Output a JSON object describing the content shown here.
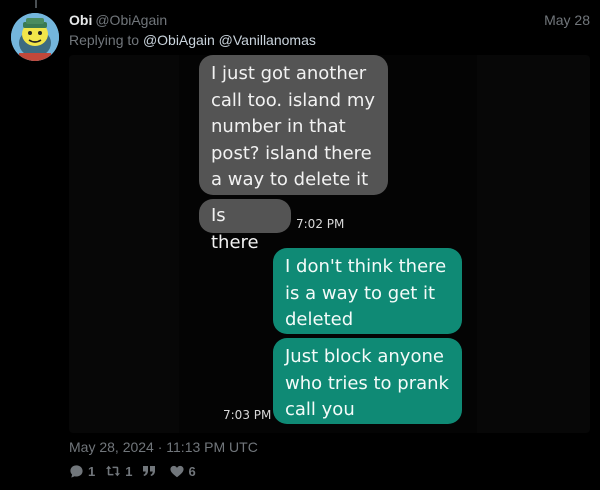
{
  "post": {
    "author_name": "Obi",
    "author_handle": "@ObiAgain",
    "date": "May 28",
    "replying_prefix": "Replying to",
    "reply_mentions": [
      "@ObiAgain",
      "@Vanillanomas"
    ],
    "timestamp": "May 28, 2024 · 11:13 PM UTC"
  },
  "screenshot": {
    "messages": [
      {
        "side": "incoming",
        "lines": [
          "I just got another",
          "call too. island my",
          "number in that",
          "post? island there",
          "a way to delete it"
        ]
      },
      {
        "side": "incoming",
        "lines": [
          "Is there"
        ],
        "time": "7:02 PM"
      },
      {
        "side": "outgoing",
        "lines": [
          "I don't think there",
          "is a way to get it",
          "deleted"
        ]
      },
      {
        "side": "outgoing",
        "lines": [
          "Just block anyone",
          "who tries to prank",
          "call you"
        ],
        "time": "7:03 PM"
      }
    ]
  },
  "actions": {
    "replies": {
      "icon": "reply-icon",
      "count": "1"
    },
    "reposts": {
      "icon": "repost-icon",
      "count": "1"
    },
    "quote": {
      "icon": "quote-icon"
    },
    "likes": {
      "icon": "heart-icon",
      "count": "6"
    }
  }
}
